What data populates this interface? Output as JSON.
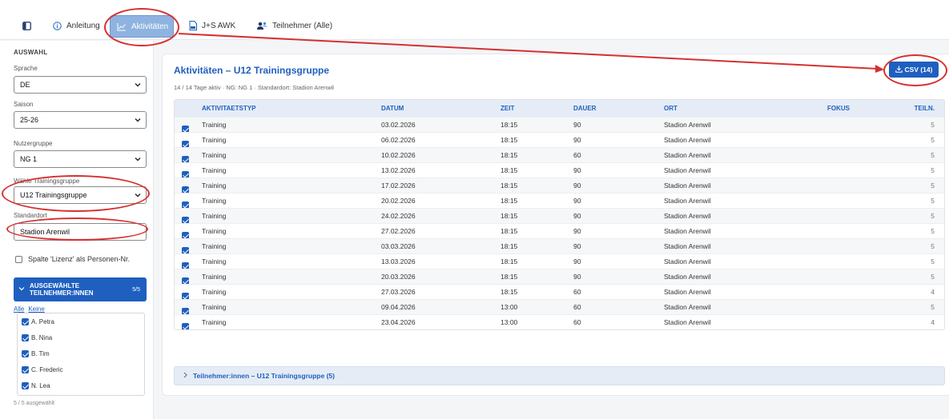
{
  "tabs": {
    "anleitung": "Anleitung",
    "aktivitaeten": "Aktivitäten",
    "js_awk": "J+S AWK",
    "teilnehmer": "Teilnehmer (Alle)"
  },
  "sidebar": {
    "heading": "AUSWAHL",
    "sprache_label": "Sprache",
    "sprache_value": "DE",
    "saison_label": "Saison",
    "saison_value": "25-26",
    "nutzergruppe_label": "Nutzergruppe",
    "nutzergruppe_value": "NG 1",
    "trainingsgruppe_label": "Wähle Trainingsgruppe",
    "trainingsgruppe_value": "U12 Trainingsgruppe",
    "standardort_label": "Standardort",
    "standardort_value": "Stadion Arenwil",
    "lizenz_checkbox_label": "Spalte 'Lizenz' als Personen-Nr.",
    "selected_header_line1": "AUSGEWÄHLTE",
    "selected_header_line2": "TEILNEHMER:INNEN",
    "selected_count": "5/5",
    "link_alle": "Alle",
    "link_keine": "Keine",
    "participants": [
      "A. Petra",
      "B. Nina",
      "B. Tim",
      "C. Frederic",
      "N. Lea"
    ],
    "selected_footer": "5 / 5 ausgewählt"
  },
  "main": {
    "title": "Aktivitäten – U12 Trainingsgruppe",
    "subtitle": "14 / 14 Tage aktiv · NG: NG 1 · Standardort: Stadion Arenwil",
    "csv_button": "CSV (14)",
    "columns": [
      "AKTIVITAETSTYP",
      "DATUM",
      "ZEIT",
      "DAUER",
      "ORT",
      "FOKUS",
      "TEILN."
    ],
    "rows": [
      {
        "typ": "Training",
        "datum": "03.02.2026",
        "zeit": "18:15",
        "dauer": "90",
        "ort": "Stadion Arenwil",
        "fokus": "",
        "teiln": "5"
      },
      {
        "typ": "Training",
        "datum": "06.02.2026",
        "zeit": "18:15",
        "dauer": "90",
        "ort": "Stadion Arenwil",
        "fokus": "",
        "teiln": "5"
      },
      {
        "typ": "Training",
        "datum": "10.02.2026",
        "zeit": "18:15",
        "dauer": "60",
        "ort": "Stadion Arenwil",
        "fokus": "",
        "teiln": "5"
      },
      {
        "typ": "Training",
        "datum": "13.02.2026",
        "zeit": "18:15",
        "dauer": "90",
        "ort": "Stadion Arenwil",
        "fokus": "",
        "teiln": "5"
      },
      {
        "typ": "Training",
        "datum": "17.02.2026",
        "zeit": "18:15",
        "dauer": "90",
        "ort": "Stadion Arenwil",
        "fokus": "",
        "teiln": "5"
      },
      {
        "typ": "Training",
        "datum": "20.02.2026",
        "zeit": "18:15",
        "dauer": "90",
        "ort": "Stadion Arenwil",
        "fokus": "",
        "teiln": "5"
      },
      {
        "typ": "Training",
        "datum": "24.02.2026",
        "zeit": "18:15",
        "dauer": "90",
        "ort": "Stadion Arenwil",
        "fokus": "",
        "teiln": "5"
      },
      {
        "typ": "Training",
        "datum": "27.02.2026",
        "zeit": "18:15",
        "dauer": "90",
        "ort": "Stadion Arenwil",
        "fokus": "",
        "teiln": "5"
      },
      {
        "typ": "Training",
        "datum": "03.03.2026",
        "zeit": "18:15",
        "dauer": "90",
        "ort": "Stadion Arenwil",
        "fokus": "",
        "teiln": "5"
      },
      {
        "typ": "Training",
        "datum": "13.03.2026",
        "zeit": "18:15",
        "dauer": "90",
        "ort": "Stadion Arenwil",
        "fokus": "",
        "teiln": "5"
      },
      {
        "typ": "Training",
        "datum": "20.03.2026",
        "zeit": "18:15",
        "dauer": "90",
        "ort": "Stadion Arenwil",
        "fokus": "",
        "teiln": "5"
      },
      {
        "typ": "Training",
        "datum": "27.03.2026",
        "zeit": "18:15",
        "dauer": "60",
        "ort": "Stadion Arenwil",
        "fokus": "",
        "teiln": "4"
      },
      {
        "typ": "Training",
        "datum": "09.04.2026",
        "zeit": "13:00",
        "dauer": "60",
        "ort": "Stadion Arenwil",
        "fokus": "",
        "teiln": "5"
      },
      {
        "typ": "Training",
        "datum": "23.04.2026",
        "zeit": "13:00",
        "dauer": "60",
        "ort": "Stadion Arenwil",
        "fokus": "",
        "teiln": "4"
      }
    ],
    "collapsed_section": "Teilnehmer:innen – U12 Trainingsgruppe (5)"
  },
  "colors": {
    "accent": "#1f5fbf",
    "header_bg": "#e5ecf6",
    "annotation_red": "#d63030"
  }
}
